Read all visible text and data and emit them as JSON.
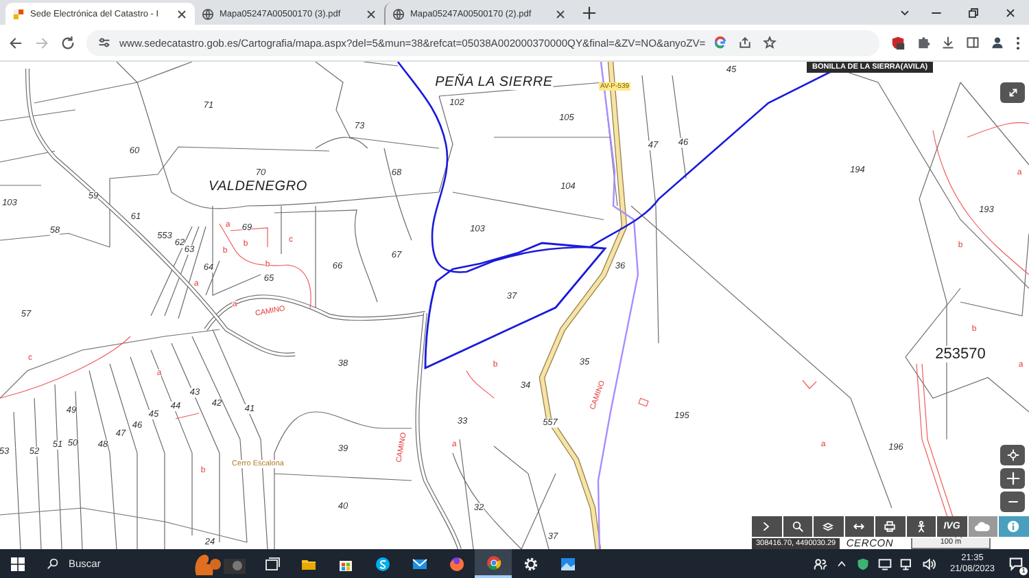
{
  "tabs": [
    {
      "title": "Sede Electrónica del Catastro - I",
      "kind": "site",
      "selected": true
    },
    {
      "title": "Mapa05247A00500170 (3).pdf",
      "kind": "pdf",
      "selected": false
    },
    {
      "title": "Mapa05247A00500170 (2).pdf",
      "kind": "pdf",
      "selected": false
    }
  ],
  "address_bar": {
    "url": "www.sedecatastro.gob.es/Cartografia/mapa.aspx?del=5&mun=38&refcat=05038A002000370000QY&final=&ZV=NO&anyoZV="
  },
  "map": {
    "municipality": "BONILLA DE LA SIERRA(AVILA)",
    "labels": [
      {
        "text": "45",
        "kind": "parcel"
      },
      {
        "text": "PEÑA LA SIERRE",
        "kind": "place"
      },
      {
        "text": "AV-P-539",
        "kind": "road"
      },
      {
        "text": "71",
        "kind": "parcel"
      },
      {
        "text": "73",
        "kind": "parcel"
      },
      {
        "text": "102",
        "kind": "parcel"
      },
      {
        "text": "105",
        "kind": "parcel"
      },
      {
        "text": "47",
        "kind": "parcel"
      },
      {
        "text": "46",
        "kind": "parcel"
      },
      {
        "text": "60",
        "kind": "parcel"
      },
      {
        "text": "70",
        "kind": "parcel"
      },
      {
        "text": "VALDENEGRO",
        "kind": "place"
      },
      {
        "text": "68",
        "kind": "parcel"
      },
      {
        "text": "104",
        "kind": "parcel"
      },
      {
        "text": "194",
        "kind": "parcel"
      },
      {
        "text": "103",
        "kind": "parcel"
      },
      {
        "text": "59",
        "kind": "parcel"
      },
      {
        "text": "61",
        "kind": "parcel"
      },
      {
        "text": "58",
        "kind": "parcel"
      },
      {
        "text": "103",
        "kind": "parcel"
      },
      {
        "text": "193",
        "kind": "parcel"
      },
      {
        "text": "a",
        "kind": "subparcel"
      },
      {
        "text": "69",
        "kind": "parcel"
      },
      {
        "text": "553",
        "kind": "parcel"
      },
      {
        "text": "62",
        "kind": "parcel"
      },
      {
        "text": "b",
        "kind": "subparcel"
      },
      {
        "text": "c",
        "kind": "subparcel"
      },
      {
        "text": "63",
        "kind": "parcel"
      },
      {
        "text": "b",
        "kind": "subparcel"
      },
      {
        "text": "64",
        "kind": "parcel"
      },
      {
        "text": "b",
        "kind": "subparcel"
      },
      {
        "text": "65",
        "kind": "parcel"
      },
      {
        "text": "66",
        "kind": "parcel"
      },
      {
        "text": "67",
        "kind": "parcel"
      },
      {
        "text": "36",
        "kind": "parcel"
      },
      {
        "text": "a",
        "kind": "subparcel"
      },
      {
        "text": "a",
        "kind": "subparcel"
      },
      {
        "text": "37",
        "kind": "parcel"
      },
      {
        "text": "57",
        "kind": "parcel"
      },
      {
        "text": "CAMINO",
        "kind": "path"
      },
      {
        "text": "a",
        "kind": "subparcel"
      },
      {
        "text": "b",
        "kind": "subparcel"
      },
      {
        "text": "b",
        "kind": "subparcel"
      },
      {
        "text": "c",
        "kind": "subparcel"
      },
      {
        "text": "a",
        "kind": "subparcel"
      },
      {
        "text": "38",
        "kind": "parcel"
      },
      {
        "text": "b",
        "kind": "subparcel"
      },
      {
        "text": "253570",
        "kind": "sheet"
      },
      {
        "text": "a",
        "kind": "subparcel"
      },
      {
        "text": "41",
        "kind": "parcel"
      },
      {
        "text": "42",
        "kind": "parcel"
      },
      {
        "text": "43",
        "kind": "parcel"
      },
      {
        "text": "44",
        "kind": "parcel"
      },
      {
        "text": "45",
        "kind": "parcel"
      },
      {
        "text": "46",
        "kind": "parcel"
      },
      {
        "text": "47",
        "kind": "parcel"
      },
      {
        "text": "49",
        "kind": "parcel"
      },
      {
        "text": "53",
        "kind": "parcel"
      },
      {
        "text": "52",
        "kind": "parcel"
      },
      {
        "text": "51",
        "kind": "parcel"
      },
      {
        "text": "50",
        "kind": "parcel"
      },
      {
        "text": "48",
        "kind": "parcel"
      },
      {
        "text": "b",
        "kind": "subparcel"
      },
      {
        "text": "Cerro Escalona",
        "kind": "locality"
      },
      {
        "text": "39",
        "kind": "parcel"
      },
      {
        "text": "CAMINO",
        "kind": "path"
      },
      {
        "text": "33",
        "kind": "parcel"
      },
      {
        "text": "a",
        "kind": "subparcel"
      },
      {
        "text": "35",
        "kind": "parcel"
      },
      {
        "text": "34",
        "kind": "parcel"
      },
      {
        "text": "CAMINO",
        "kind": "path"
      },
      {
        "text": "557",
        "kind": "parcel"
      },
      {
        "text": "195",
        "kind": "parcel"
      },
      {
        "text": "a",
        "kind": "subparcel"
      },
      {
        "text": "196",
        "kind": "parcel"
      },
      {
        "text": "40",
        "kind": "parcel"
      },
      {
        "text": "32",
        "kind": "parcel"
      },
      {
        "text": "37",
        "kind": "parcel"
      },
      {
        "text": "24",
        "kind": "parcel"
      },
      {
        "text": "CERCON",
        "kind": "place"
      }
    ],
    "tools": [
      {
        "kind": "expand",
        "selected": false
      },
      {
        "kind": "search",
        "selected": false
      },
      {
        "kind": "layers",
        "selected": false
      },
      {
        "kind": "measure",
        "selected": false
      },
      {
        "kind": "print",
        "selected": false
      },
      {
        "kind": "figure",
        "selected": false
      },
      {
        "kind": "text",
        "label": "IVG",
        "selected": false
      },
      {
        "kind": "cloud",
        "selected": true
      },
      {
        "kind": "info",
        "selected": false
      }
    ],
    "coordinates": "308416.70, 4490030.29",
    "scale": "100 m"
  },
  "taskbar": {
    "search_placeholder": "Buscar",
    "apps": [
      {
        "kind": "taskview",
        "selected": false
      },
      {
        "kind": "folder",
        "selected": false
      },
      {
        "kind": "store",
        "selected": false
      },
      {
        "kind": "chat",
        "selected": false
      },
      {
        "kind": "mail",
        "selected": false
      },
      {
        "kind": "fox",
        "selected": false
      },
      {
        "kind": "chrome",
        "selected": true
      },
      {
        "kind": "gear",
        "selected": false
      },
      {
        "kind": "photos",
        "selected": false
      }
    ],
    "time": "21:35",
    "date": "21/08/2023",
    "notifications": "1"
  }
}
